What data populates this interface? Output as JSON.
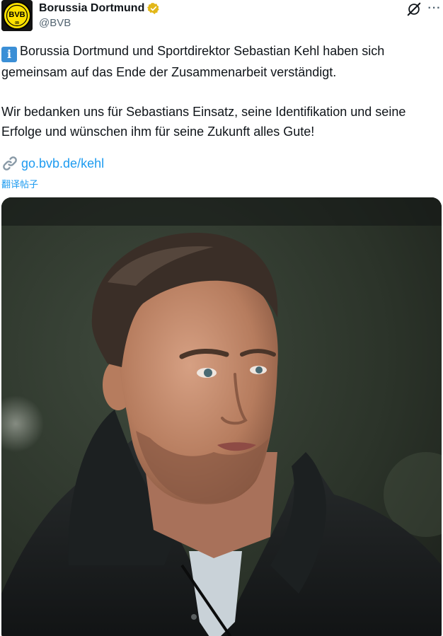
{
  "author": {
    "name": "Borussia Dortmund",
    "handle": "@BVB",
    "avatar_icon": "bvb-logo-icon",
    "avatar_text": "BVB",
    "verified_icon": "verified-gold-badge-icon",
    "verified_color": "#e2b719"
  },
  "header_actions": {
    "grok_icon": "grok-icon",
    "more_icon": "more-options-icon",
    "more_label": "···"
  },
  "post": {
    "info_icon": "information-icon",
    "info_glyph": "i",
    "paragraph1": "Borussia Dortmund und Sportdirektor Sebastian Kehl haben sich gemeinsam auf das Ende der Zusammenarbeit verständigt.",
    "paragraph2": "Wir bedanken uns für Sebastians Einsatz, seine Identifikation und seine Erfolge und wünschen ihm für seine Zukunft alles Gute!",
    "link_icon": "link-chain-icon",
    "link_text": "go.bvb.de/kehl",
    "translate_label": "翻译帖子"
  },
  "media": {
    "type": "photo",
    "subject": "man-in-black-puffer-jacket-photo"
  },
  "colors": {
    "link": "#1d9bf0",
    "secondary_text": "#536471",
    "brand_yellow": "#fde100"
  }
}
